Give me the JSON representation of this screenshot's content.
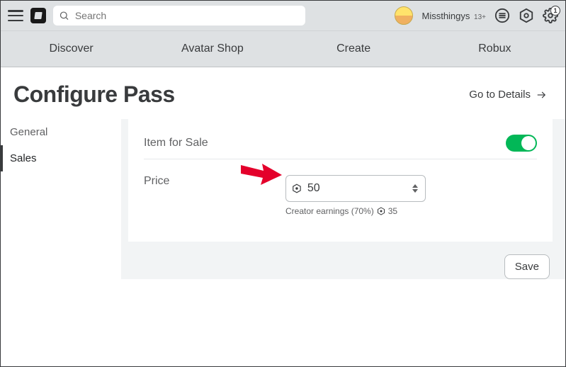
{
  "topbar": {
    "search_placeholder": "Search",
    "username": "Missthingys",
    "age_tag": "13+",
    "notif_badge": "1"
  },
  "nav": {
    "items": [
      "Discover",
      "Avatar Shop",
      "Create",
      "Robux"
    ]
  },
  "header": {
    "title": "Configure Pass",
    "details_link": "Go to Details"
  },
  "sidebar": {
    "items": [
      {
        "label": "General",
        "active": false
      },
      {
        "label": "Sales",
        "active": true
      }
    ]
  },
  "form": {
    "item_for_sale_label": "Item for Sale",
    "item_for_sale_on": true,
    "price_label": "Price",
    "price_value": "50",
    "earnings_label": "Creator earnings (70%)",
    "earnings_value": "35"
  },
  "actions": {
    "save": "Save"
  }
}
